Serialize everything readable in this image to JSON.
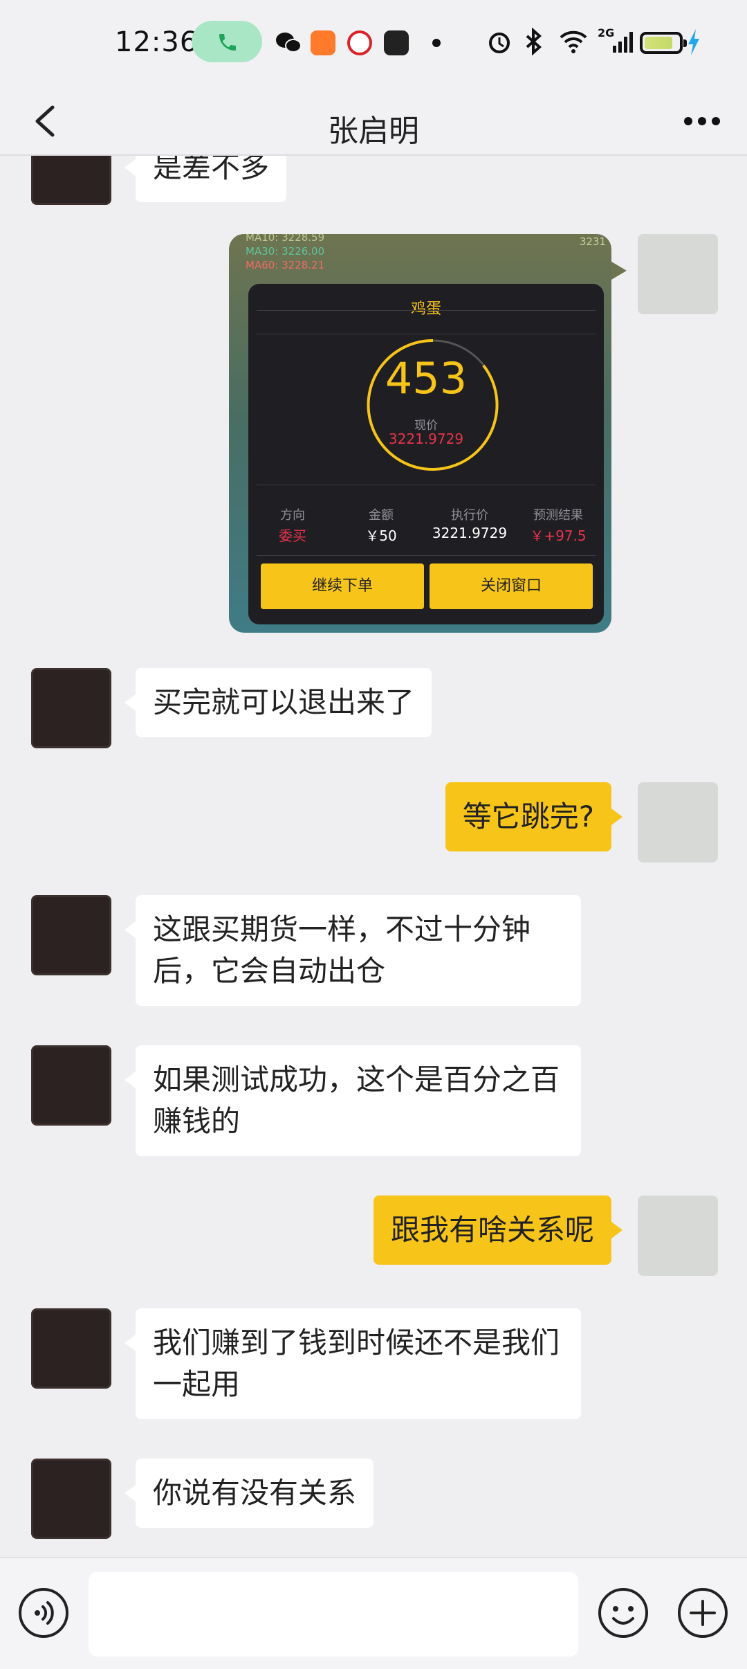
{
  "status_bar": {
    "time": "12:36",
    "network": "2G"
  },
  "header": {
    "title": "张启明"
  },
  "image_message": {
    "ma_lines": [
      "MA10: 3228.59",
      "MA30: 3226.00",
      "MA60: 3228.21"
    ],
    "ma_colors": [
      "#b9c890",
      "#5ec49b",
      "#f06c62"
    ],
    "corner_value": "3231",
    "panel_title": "鸡蛋",
    "gauge_value": "453",
    "price_label": "现价",
    "price_value": "3221.9729",
    "columns": [
      {
        "label": "方向",
        "value": "委买"
      },
      {
        "label": "金额",
        "value": "￥50"
      },
      {
        "label": "执行价",
        "value": "3221.9729"
      },
      {
        "label": "预测结果",
        "value": "￥+97.5"
      }
    ],
    "btn_continue": "继续下单",
    "btn_close": "关闭窗口"
  },
  "messages": {
    "m0": "是差不多",
    "m1": "买完就可以退出来了",
    "m2": "等它跳完?",
    "m3": "这跟买期货一样，不过十分钟后，它会自动出仓",
    "m4": "如果测试成功，这个是百分之百赚钱的",
    "m5": "跟我有啥关系呢",
    "m6": "我们赚到了钱到时候还不是我们一起用",
    "m7": "你说有没有关系"
  },
  "colors": {
    "accent": "#f7c419",
    "bubble_left": "#ffffff",
    "background": "#efeff2"
  }
}
